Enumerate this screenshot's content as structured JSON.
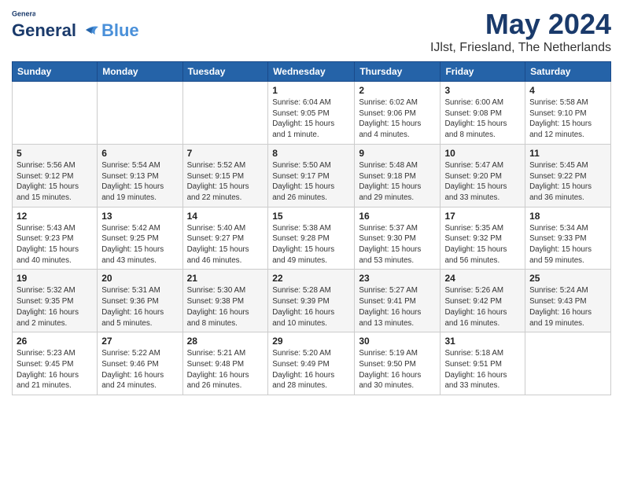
{
  "logo": {
    "general": "General",
    "blue": "Blue"
  },
  "title": "May 2024",
  "location": "IJlst, Friesland, The Netherlands",
  "days_of_week": [
    "Sunday",
    "Monday",
    "Tuesday",
    "Wednesday",
    "Thursday",
    "Friday",
    "Saturday"
  ],
  "weeks": [
    [
      {
        "day": "",
        "info": ""
      },
      {
        "day": "",
        "info": ""
      },
      {
        "day": "",
        "info": ""
      },
      {
        "day": "1",
        "info": "Sunrise: 6:04 AM\nSunset: 9:05 PM\nDaylight: 15 hours\nand 1 minute."
      },
      {
        "day": "2",
        "info": "Sunrise: 6:02 AM\nSunset: 9:06 PM\nDaylight: 15 hours\nand 4 minutes."
      },
      {
        "day": "3",
        "info": "Sunrise: 6:00 AM\nSunset: 9:08 PM\nDaylight: 15 hours\nand 8 minutes."
      },
      {
        "day": "4",
        "info": "Sunrise: 5:58 AM\nSunset: 9:10 PM\nDaylight: 15 hours\nand 12 minutes."
      }
    ],
    [
      {
        "day": "5",
        "info": "Sunrise: 5:56 AM\nSunset: 9:12 PM\nDaylight: 15 hours\nand 15 minutes."
      },
      {
        "day": "6",
        "info": "Sunrise: 5:54 AM\nSunset: 9:13 PM\nDaylight: 15 hours\nand 19 minutes."
      },
      {
        "day": "7",
        "info": "Sunrise: 5:52 AM\nSunset: 9:15 PM\nDaylight: 15 hours\nand 22 minutes."
      },
      {
        "day": "8",
        "info": "Sunrise: 5:50 AM\nSunset: 9:17 PM\nDaylight: 15 hours\nand 26 minutes."
      },
      {
        "day": "9",
        "info": "Sunrise: 5:48 AM\nSunset: 9:18 PM\nDaylight: 15 hours\nand 29 minutes."
      },
      {
        "day": "10",
        "info": "Sunrise: 5:47 AM\nSunset: 9:20 PM\nDaylight: 15 hours\nand 33 minutes."
      },
      {
        "day": "11",
        "info": "Sunrise: 5:45 AM\nSunset: 9:22 PM\nDaylight: 15 hours\nand 36 minutes."
      }
    ],
    [
      {
        "day": "12",
        "info": "Sunrise: 5:43 AM\nSunset: 9:23 PM\nDaylight: 15 hours\nand 40 minutes."
      },
      {
        "day": "13",
        "info": "Sunrise: 5:42 AM\nSunset: 9:25 PM\nDaylight: 15 hours\nand 43 minutes."
      },
      {
        "day": "14",
        "info": "Sunrise: 5:40 AM\nSunset: 9:27 PM\nDaylight: 15 hours\nand 46 minutes."
      },
      {
        "day": "15",
        "info": "Sunrise: 5:38 AM\nSunset: 9:28 PM\nDaylight: 15 hours\nand 49 minutes."
      },
      {
        "day": "16",
        "info": "Sunrise: 5:37 AM\nSunset: 9:30 PM\nDaylight: 15 hours\nand 53 minutes."
      },
      {
        "day": "17",
        "info": "Sunrise: 5:35 AM\nSunset: 9:32 PM\nDaylight: 15 hours\nand 56 minutes."
      },
      {
        "day": "18",
        "info": "Sunrise: 5:34 AM\nSunset: 9:33 PM\nDaylight: 15 hours\nand 59 minutes."
      }
    ],
    [
      {
        "day": "19",
        "info": "Sunrise: 5:32 AM\nSunset: 9:35 PM\nDaylight: 16 hours\nand 2 minutes."
      },
      {
        "day": "20",
        "info": "Sunrise: 5:31 AM\nSunset: 9:36 PM\nDaylight: 16 hours\nand 5 minutes."
      },
      {
        "day": "21",
        "info": "Sunrise: 5:30 AM\nSunset: 9:38 PM\nDaylight: 16 hours\nand 8 minutes."
      },
      {
        "day": "22",
        "info": "Sunrise: 5:28 AM\nSunset: 9:39 PM\nDaylight: 16 hours\nand 10 minutes."
      },
      {
        "day": "23",
        "info": "Sunrise: 5:27 AM\nSunset: 9:41 PM\nDaylight: 16 hours\nand 13 minutes."
      },
      {
        "day": "24",
        "info": "Sunrise: 5:26 AM\nSunset: 9:42 PM\nDaylight: 16 hours\nand 16 minutes."
      },
      {
        "day": "25",
        "info": "Sunrise: 5:24 AM\nSunset: 9:43 PM\nDaylight: 16 hours\nand 19 minutes."
      }
    ],
    [
      {
        "day": "26",
        "info": "Sunrise: 5:23 AM\nSunset: 9:45 PM\nDaylight: 16 hours\nand 21 minutes."
      },
      {
        "day": "27",
        "info": "Sunrise: 5:22 AM\nSunset: 9:46 PM\nDaylight: 16 hours\nand 24 minutes."
      },
      {
        "day": "28",
        "info": "Sunrise: 5:21 AM\nSunset: 9:48 PM\nDaylight: 16 hours\nand 26 minutes."
      },
      {
        "day": "29",
        "info": "Sunrise: 5:20 AM\nSunset: 9:49 PM\nDaylight: 16 hours\nand 28 minutes."
      },
      {
        "day": "30",
        "info": "Sunrise: 5:19 AM\nSunset: 9:50 PM\nDaylight: 16 hours\nand 30 minutes."
      },
      {
        "day": "31",
        "info": "Sunrise: 5:18 AM\nSunset: 9:51 PM\nDaylight: 16 hours\nand 33 minutes."
      },
      {
        "day": "",
        "info": ""
      }
    ]
  ]
}
